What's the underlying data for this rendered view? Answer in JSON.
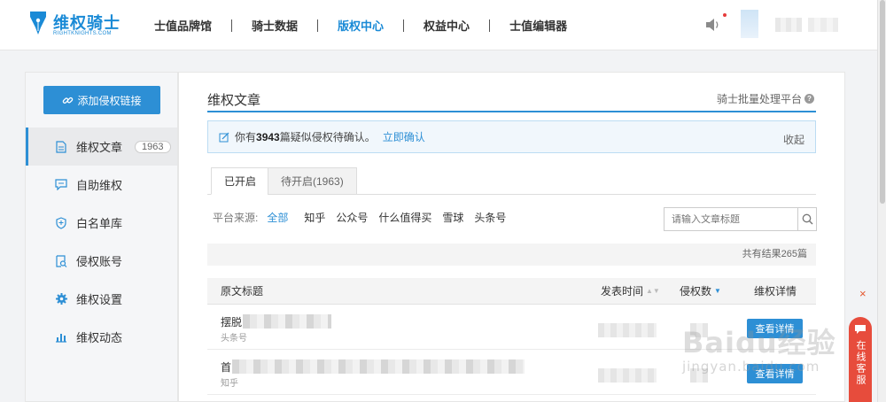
{
  "brand": {
    "name_cn": "维权骑士",
    "name_en": "RIGHTKNIGHTS.COM",
    "color": "#1a8ad6"
  },
  "nav": {
    "items": [
      {
        "label": "士值品牌馆",
        "active": false
      },
      {
        "label": "骑士数据",
        "active": false
      },
      {
        "label": "版权中心",
        "active": true
      },
      {
        "label": "权益中心",
        "active": false
      },
      {
        "label": "士值编辑器",
        "active": false
      }
    ]
  },
  "header_icons": {
    "speaker": "speaker-icon",
    "notification_dot_color": "#e63b3b"
  },
  "sidebar": {
    "add_button": "添加侵权链接",
    "items": [
      {
        "label": "维权文章",
        "badge": "1963",
        "icon": "document-icon",
        "active": true
      },
      {
        "label": "自助维权",
        "icon": "chat-icon",
        "active": false
      },
      {
        "label": "白名单库",
        "icon": "shield-icon",
        "active": false
      },
      {
        "label": "侵权账号",
        "icon": "search-doc-icon",
        "active": false
      },
      {
        "label": "维权设置",
        "icon": "gear-icon",
        "active": false
      },
      {
        "label": "维权动态",
        "icon": "bar-chart-icon",
        "active": false
      }
    ]
  },
  "main": {
    "title": "维权文章",
    "bulk_link": "骑士批量处理平台",
    "notice": {
      "prefix": "你有",
      "count": "3943",
      "suffix": "篇疑似侵权待确认。",
      "link": "立即确认",
      "fold": "收起"
    },
    "tabs": [
      {
        "label": "已开启",
        "active": true
      },
      {
        "label": "待开启(1963)",
        "active": false
      }
    ],
    "platform": {
      "label": "平台来源:",
      "options": [
        "全部",
        "知乎",
        "公众号",
        "什么值得买",
        "雪球",
        "头条号"
      ],
      "selected": "全部"
    },
    "search": {
      "placeholder": "请输入文章标题"
    },
    "result_text": "共有结果265篇",
    "table": {
      "headers": {
        "title": "原文标题",
        "time": "发表时间",
        "count": "侵权数",
        "detail": "维权详情"
      },
      "rows": [
        {
          "title_prefix": "摆脱",
          "source": "头条号",
          "button": "查看详情"
        },
        {
          "title_prefix": "首",
          "source": "知乎",
          "button": "查看详情"
        }
      ]
    }
  },
  "floating": {
    "chat": "在线客服",
    "close": "×"
  },
  "watermark": {
    "main": "Baidu经验",
    "sub": "jingyan.baidu.com"
  },
  "colors": {
    "accent": "#2d8fd5",
    "chat_bg": "#e74c3c"
  }
}
